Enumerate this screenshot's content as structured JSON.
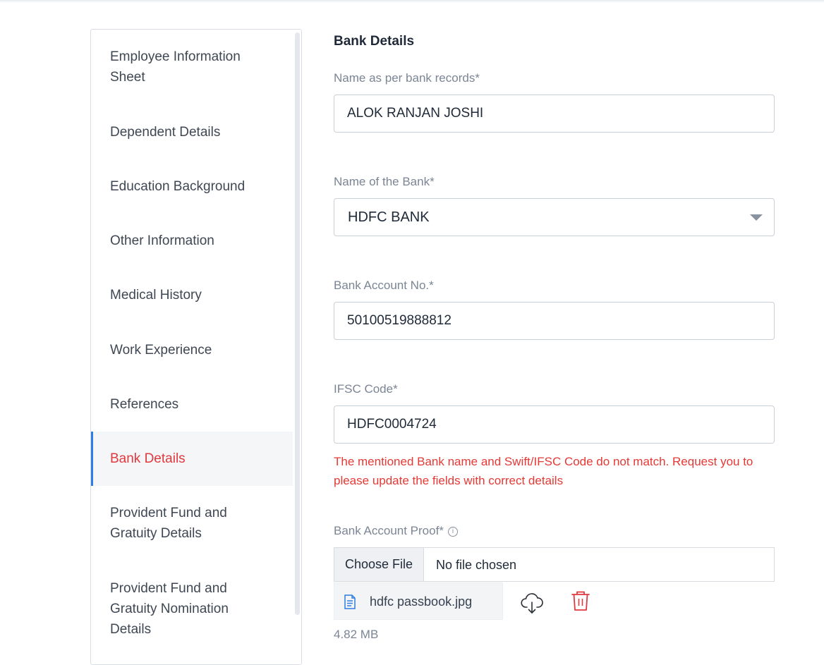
{
  "sidebar": {
    "items": [
      {
        "label": "Employee Information Sheet",
        "active": false
      },
      {
        "label": "Dependent Details",
        "active": false
      },
      {
        "label": "Education Background",
        "active": false
      },
      {
        "label": "Other Information",
        "active": false
      },
      {
        "label": "Medical History",
        "active": false
      },
      {
        "label": "Work Experience",
        "active": false
      },
      {
        "label": "References",
        "active": false
      },
      {
        "label": "Bank Details",
        "active": true
      },
      {
        "label": "Provident Fund and Gratuity Details",
        "active": false
      },
      {
        "label": "Provident Fund and Gratuity Nomination Details",
        "active": false
      }
    ]
  },
  "form": {
    "title": "Bank Details",
    "name_label": "Name as per bank records*",
    "name_value": "ALOK RANJAN JOSHI",
    "bank_label": "Name of the Bank*",
    "bank_value": "HDFC BANK",
    "account_label": "Bank Account No.*",
    "account_value": "50100519888812",
    "ifsc_label": "IFSC Code*",
    "ifsc_value": "HDFC0004724",
    "error_message": "The mentioned Bank name and Swift/IFSC Code do not match. Request you to please update the fields with correct details",
    "proof_label": "Bank Account Proof*",
    "info_glyph": "i",
    "choose_file_label": "Choose File",
    "no_file_text": "No file chosen",
    "uploaded_file_name": "hdfc passbook.jpg",
    "uploaded_file_size": "4.82 MB"
  },
  "colors": {
    "accent_active": "#e0393e",
    "active_indicator": "#2f7de1",
    "error": "#e53935",
    "delete_icon": "#e0393e",
    "file_icon": "#2f7de1"
  },
  "icons": {
    "file": "document-icon",
    "download": "cloud-download-icon",
    "delete": "trash-icon",
    "info": "info-icon",
    "dropdown": "chevron-down-icon"
  }
}
